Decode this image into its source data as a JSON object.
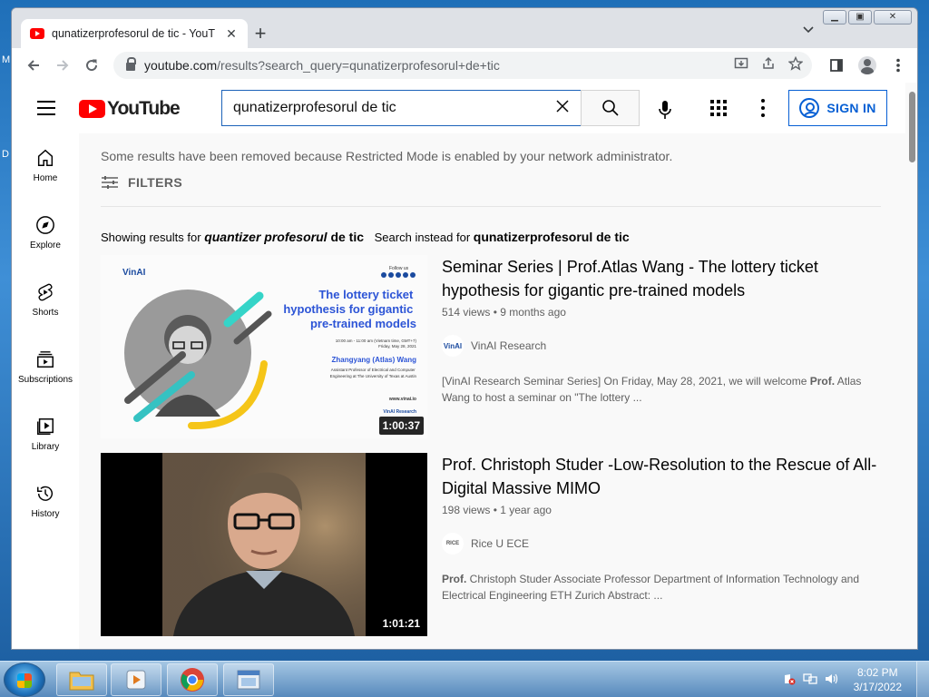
{
  "browser": {
    "tab_title": "qunatizerprofesorul de tic - YouTube",
    "tab_close": "✕",
    "new_tab": "+",
    "tab_dropdown": "⌄",
    "url_host": "youtube.com",
    "url_path": "/results?search_query=qunatizerprofesorul+de+tic"
  },
  "youtube": {
    "logo_text": "YouTube",
    "search_value": "qunatizerprofesorul de tic",
    "sign_in": "SIGN IN",
    "guide": [
      {
        "label": "Home",
        "icon": "home-icon"
      },
      {
        "label": "Explore",
        "icon": "compass-icon"
      },
      {
        "label": "Shorts",
        "icon": "shorts-icon"
      },
      {
        "label": "Subscriptions",
        "icon": "subscriptions-icon"
      },
      {
        "label": "Library",
        "icon": "library-icon"
      },
      {
        "label": "History",
        "icon": "history-icon"
      }
    ],
    "notice": "Some results have been removed because Restricted Mode is enabled by your network administrator.",
    "filters_label": "FILTERS",
    "showing_prefix": "Showing results for",
    "showing_corrected_italic": "quantizer profesorul",
    "showing_corrected_rest": "de tic",
    "instead_prefix": "Search instead for",
    "instead_original": "qunatizerprofesorul de tic",
    "videos": [
      {
        "title": "Seminar Series | Prof.Atlas Wang - The lottery ticket hypothesis for gigantic pre-trained models",
        "stats": "514 views • 9 months ago",
        "channel": "VinAI Research",
        "channel_logo": "VinAI",
        "description_pre": "[VinAI Research Seminar Series] On Friday, May 28, 2021, we will welcome ",
        "description_bold": "Prof.",
        "description_post": " Atlas Wang to host a seminar on \"The lottery ...",
        "duration": "1:00:37",
        "thumb": {
          "brand": "VinAI",
          "follow": "Follow us",
          "headline": "The lottery ticket hypothesis for gigantic pre-trained models",
          "time": "10:00 am - 11:00 am (Vietnam time, GMT+7)",
          "date": "Friday, May 28, 2021",
          "speaker": "Zhangyang (Atlas) Wang",
          "affil": "Assistant Professor of Electrical and Computer Engineering at The University of Texas at Austin",
          "site": "www.vinai.io",
          "footer": "VinAI Research"
        }
      },
      {
        "title": "Prof. Christoph Studer -Low-Resolution to the Rescue of All-Digital Massive MIMO",
        "stats": "198 views • 1 year ago",
        "channel": "Rice U ECE",
        "channel_logo": "RICE",
        "description_pre": "",
        "description_bold": "Prof.",
        "description_post": " Christoph Studer Associate Professor Department of Information Technology and Electrical Engineering ETH Zurich Abstract: ...",
        "duration": "1:01:21"
      }
    ]
  },
  "taskbar": {
    "time": "8:02 PM",
    "date": "3/17/2022"
  },
  "colors": {
    "accent_blue": "#065fd4",
    "yt_red": "#ff0000"
  }
}
